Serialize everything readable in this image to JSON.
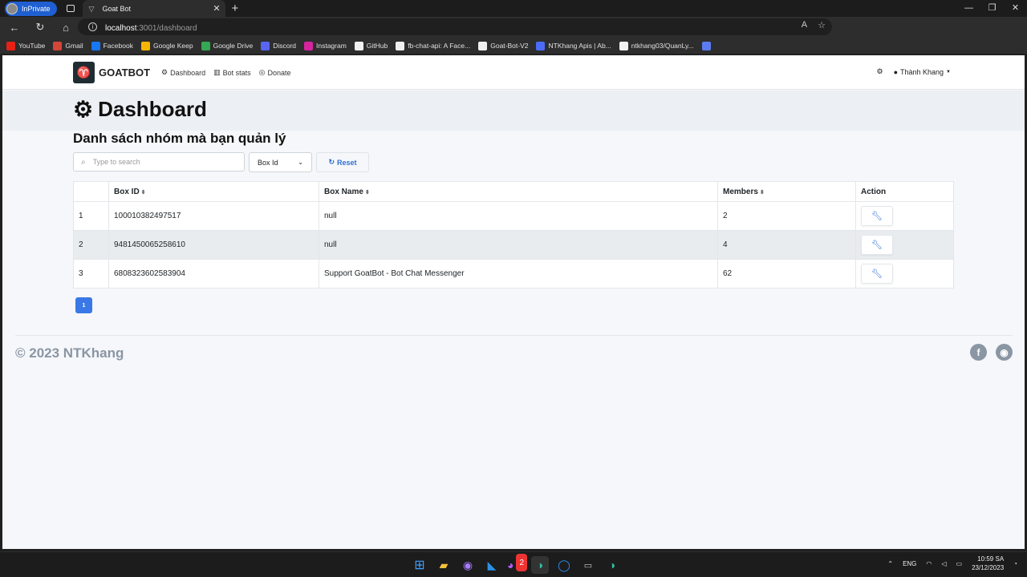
{
  "browser": {
    "inprivate_label": "InPrivate",
    "tab_title": "Goat Bot",
    "url_host": "localhost",
    "url_path": ":3001/dashboard",
    "bookmarks": [
      {
        "label": "YouTube",
        "color": "#e62117"
      },
      {
        "label": "Gmail",
        "color": "#d44638"
      },
      {
        "label": "Facebook",
        "color": "#1877f2"
      },
      {
        "label": "Google Keep",
        "color": "#f6b400"
      },
      {
        "label": "Google Drive",
        "color": "#34a853"
      },
      {
        "label": "Discord",
        "color": "#5865f2"
      },
      {
        "label": "Instagram",
        "color": "#d6249f"
      },
      {
        "label": "GitHub",
        "color": "#f0f0f0"
      },
      {
        "label": "fb-chat-api: A Face...",
        "color": "#f0f0f0"
      },
      {
        "label": "Goat-Bot-V2",
        "color": "#f0f0f0"
      },
      {
        "label": "NTKhang Apis | Ab...",
        "color": "#4a6cf7"
      },
      {
        "label": "ntkhang03/QuanLy...",
        "color": "#f0f0f0"
      }
    ]
  },
  "site": {
    "brand": "GOATBOT",
    "nav": [
      {
        "icon": "gear-icon",
        "label": "Dashboard"
      },
      {
        "icon": "chart-icon",
        "label": "Bot stats"
      },
      {
        "icon": "donate-icon",
        "label": "Donate"
      }
    ],
    "user_name": "Thành Khang"
  },
  "main": {
    "page_title": "Dashboard",
    "section_title": "Danh sách nhóm mà bạn quản lý",
    "search_placeholder": "Type to search",
    "filter_selected": "Box Id",
    "reset_label": "Reset",
    "columns": [
      "",
      "Box ID",
      "Box Name",
      "Members",
      "Action"
    ],
    "rows": [
      {
        "index": "1",
        "box_id": "100010382497517",
        "box_name": "null",
        "members": "2"
      },
      {
        "index": "2",
        "box_id": "9481450065258610",
        "box_name": "null",
        "members": "4"
      },
      {
        "index": "3",
        "box_id": "6808323602583904",
        "box_name": "Support GoatBot - Bot Chat Messenger",
        "members": "62"
      }
    ],
    "current_page": "1"
  },
  "footer": {
    "copyright": "© 2023 NTKhang"
  },
  "taskbar": {
    "language": "ENG",
    "time": "10:59 SA",
    "date": "23/12/2023",
    "messenger_badge": "2"
  },
  "colors": {
    "accent": "#3b78e7",
    "link": "#2f6fd8"
  }
}
